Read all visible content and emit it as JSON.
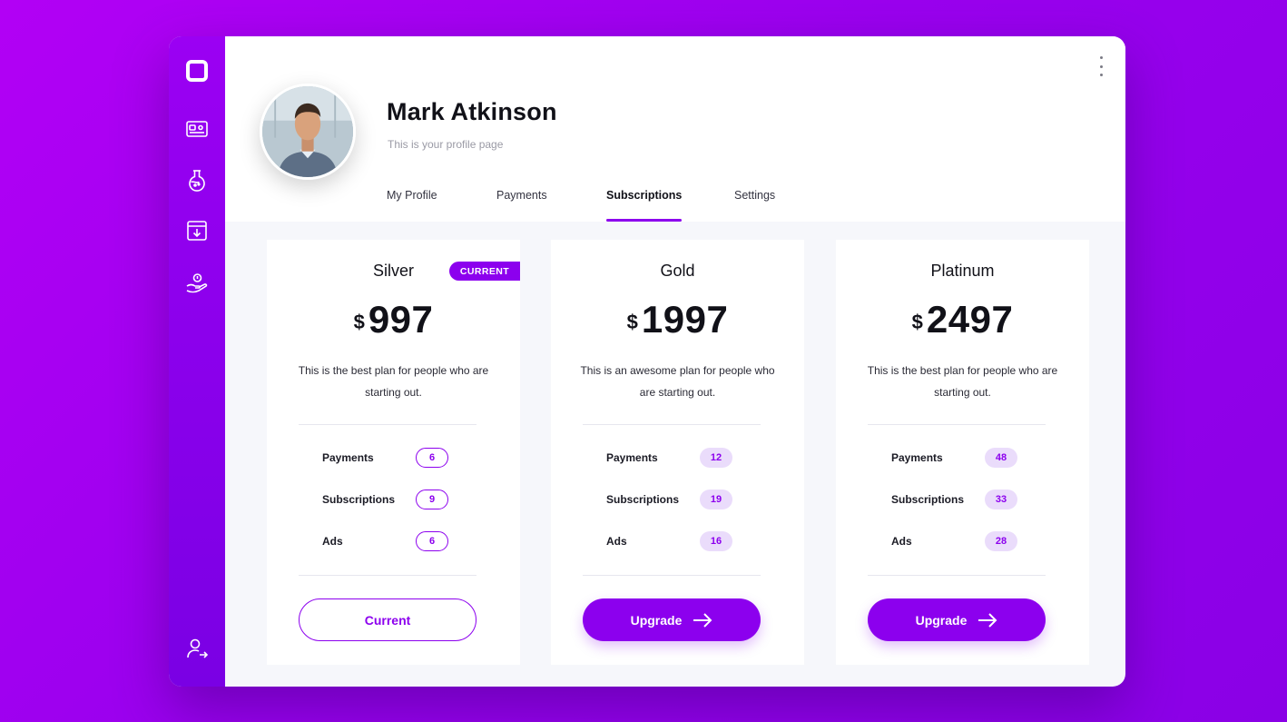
{
  "sidebar": {
    "items": [
      {
        "icon": "logo-square-icon"
      },
      {
        "icon": "card-icon"
      },
      {
        "icon": "flask-icon"
      },
      {
        "icon": "archive-download-icon"
      },
      {
        "icon": "hand-coin-icon"
      },
      {
        "icon": "user-logout-icon"
      }
    ]
  },
  "profile": {
    "name": "Mark Atkinson",
    "subtitle": "This is your profile page"
  },
  "tabs": [
    {
      "label": "My Profile",
      "active": false
    },
    {
      "label": "Payments",
      "active": false
    },
    {
      "label": "Subscriptions",
      "active": true
    },
    {
      "label": "Settings",
      "active": false
    }
  ],
  "plans": [
    {
      "name": "Silver",
      "badge": "CURRENT",
      "currency": "$",
      "price": "997",
      "description": "This is the best plan for people who are starting out.",
      "features": [
        {
          "label": "Payments",
          "value": "6"
        },
        {
          "label": "Subscriptions",
          "value": "9"
        },
        {
          "label": "Ads",
          "value": "6"
        }
      ],
      "cta": "Current"
    },
    {
      "name": "Gold",
      "currency": "$",
      "price": "1997",
      "description": "This is an awesome plan for people who are starting out.",
      "features": [
        {
          "label": "Payments",
          "value": "12"
        },
        {
          "label": "Subscriptions",
          "value": "19"
        },
        {
          "label": "Ads",
          "value": "16"
        }
      ],
      "cta": "Upgrade"
    },
    {
      "name": "Platinum",
      "currency": "$",
      "price": "2497",
      "description": "This is the best plan for people who are starting out.",
      "features": [
        {
          "label": "Payments",
          "value": "48"
        },
        {
          "label": "Subscriptions",
          "value": "33"
        },
        {
          "label": "Ads",
          "value": "28"
        }
      ],
      "cta": "Upgrade"
    }
  ],
  "colors": {
    "accent": "#8c00ee",
    "pill_bg": "#eadcfb",
    "background": "#a000f2"
  }
}
